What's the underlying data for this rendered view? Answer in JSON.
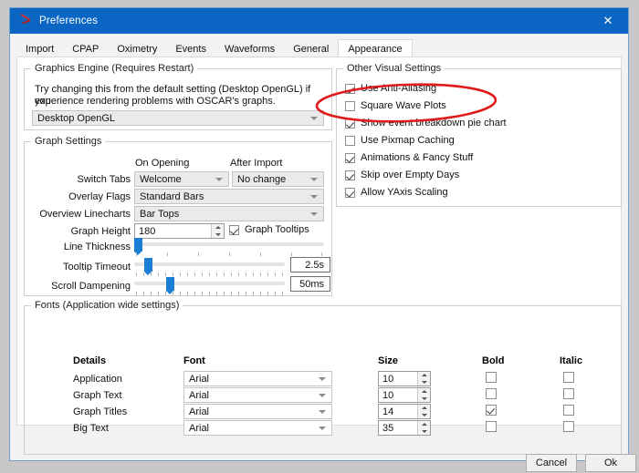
{
  "window": {
    "title": "Preferences",
    "icon": "oscar-app-icon",
    "close_label": "✕"
  },
  "tabs": [
    {
      "label": "Import",
      "active": false
    },
    {
      "label": "CPAP",
      "active": false
    },
    {
      "label": "Oximetry",
      "active": false
    },
    {
      "label": "Events",
      "active": false
    },
    {
      "label": "Waveforms",
      "active": false
    },
    {
      "label": "General",
      "active": false
    },
    {
      "label": "Appearance",
      "active": true
    }
  ],
  "graphics_engine": {
    "group_label": "Graphics Engine (Requires Restart)",
    "description_line1": "Try changing this from the default setting (Desktop OpenGL) if you",
    "description_line2": "experience rendering problems with OSCAR's graphs.",
    "engine_value": "Desktop OpenGL"
  },
  "graph_settings": {
    "group_label": "Graph Settings",
    "col_on_opening": "On Opening",
    "col_after_import": "After Import",
    "switch_tabs_label": "Switch Tabs",
    "switch_tabs_on_opening": "Welcome",
    "switch_tabs_after_import": "No change",
    "overlay_flags_label": "Overlay Flags",
    "overlay_flags_value": "Standard Bars",
    "overview_linecharts_label": "Overview Linecharts",
    "overview_linecharts_value": "Bar Tops",
    "graph_height_label": "Graph Height",
    "graph_height_value": "180",
    "graph_tooltips_label": "Graph Tooltips",
    "graph_tooltips_checked": true,
    "line_thickness_label": "Line Thickness",
    "tooltip_timeout_label": "Tooltip Timeout",
    "tooltip_timeout_value": "2.5s",
    "scroll_dampening_label": "Scroll Dampening",
    "scroll_dampening_value": "50ms"
  },
  "other_visual_settings": {
    "group_label": "Other Visual Settings",
    "items": [
      {
        "label": "Use Anti-Aliasing",
        "checked": true
      },
      {
        "label": "Square Wave Plots",
        "checked": false
      },
      {
        "label": "Show event breakdown pie chart",
        "checked": true
      },
      {
        "label": "Use Pixmap Caching",
        "checked": false
      },
      {
        "label": "Animations & Fancy Stuff",
        "checked": true
      },
      {
        "label": "Skip over Empty Days",
        "checked": true
      },
      {
        "label": "Allow YAxis Scaling",
        "checked": true
      }
    ]
  },
  "fonts": {
    "group_label": "Fonts (Application wide settings)",
    "headers": [
      "Details",
      "Font",
      "Size",
      "Bold",
      "Italic"
    ],
    "rows": [
      {
        "details": "Application",
        "font": "Arial",
        "size": "10",
        "bold": false,
        "italic": false
      },
      {
        "details": "Graph Text",
        "font": "Arial",
        "size": "10",
        "bold": false,
        "italic": false
      },
      {
        "details": "Graph Titles",
        "font": "Arial",
        "size": "14",
        "bold": true,
        "italic": false
      },
      {
        "details": "Big  Text",
        "font": "Arial",
        "size": "35",
        "bold": false,
        "italic": false
      }
    ]
  },
  "buttons": {
    "cancel": "Cancel",
    "ok": "Ok"
  },
  "annotation": {
    "type": "red-ellipse",
    "target": "Show event breakdown pie chart",
    "color": "#e01b1b"
  },
  "colors": {
    "titlebar": "#0a66c2",
    "accent": "#1a7fd4",
    "annotation": "#e01b1b",
    "desktop": "#c8c8c8"
  }
}
